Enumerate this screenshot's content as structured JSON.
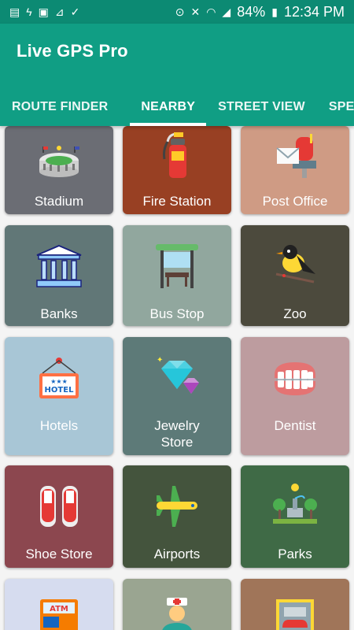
{
  "status_bar": {
    "battery": "84%",
    "time": "12:34 PM",
    "icons": [
      "notification-icon",
      "flash-icon",
      "image-icon",
      "chart-icon",
      "check-icon",
      "location-icon",
      "mute-icon",
      "wifi-icon",
      "signal-icon",
      "battery-icon"
    ]
  },
  "app": {
    "title": "Live GPS Pro"
  },
  "tabs": [
    {
      "label": "ROUTE FINDER",
      "selected": false
    },
    {
      "label": "NEARBY",
      "selected": true
    },
    {
      "label": "STREET VIEW",
      "selected": false
    },
    {
      "label": "SPEED",
      "selected": false
    }
  ],
  "colors": {
    "status_bar": "#0c8a73",
    "app_bar": "#109e84"
  },
  "places": [
    {
      "label": "Stadium",
      "icon": "stadium-icon",
      "bg": "#6b6d74"
    },
    {
      "label": "Fire Station",
      "icon": "fire-extinguisher-icon",
      "bg": "#984023"
    },
    {
      "label": "Post Office",
      "icon": "mailbox-icon",
      "bg": "#cf9b84"
    },
    {
      "label": "Banks",
      "icon": "bank-icon",
      "bg": "#617777"
    },
    {
      "label": "Bus Stop",
      "icon": "bus-stop-icon",
      "bg": "#91a79e"
    },
    {
      "label": "Zoo",
      "icon": "bird-icon",
      "bg": "#4c4a3d"
    },
    {
      "label": "Hotels",
      "icon": "hotel-sign-icon",
      "bg": "#a8c6d6"
    },
    {
      "label": "Jewelry\nStore",
      "icon": "diamond-icon",
      "bg": "#5d7a78"
    },
    {
      "label": "Dentist",
      "icon": "teeth-icon",
      "bg": "#bd9c9f"
    },
    {
      "label": "Shoe Store",
      "icon": "sneakers-icon",
      "bg": "#8c474f"
    },
    {
      "label": "Airports",
      "icon": "airplane-icon",
      "bg": "#44543d"
    },
    {
      "label": "Parks",
      "icon": "park-icon",
      "bg": "#3f6a46"
    },
    {
      "label": "",
      "icon": "atm-icon",
      "bg": "#d6dcef"
    },
    {
      "label": "",
      "icon": "nurse-icon",
      "bg": "#9aa591"
    },
    {
      "label": "",
      "icon": "car-icon",
      "bg": "#a07559"
    }
  ]
}
